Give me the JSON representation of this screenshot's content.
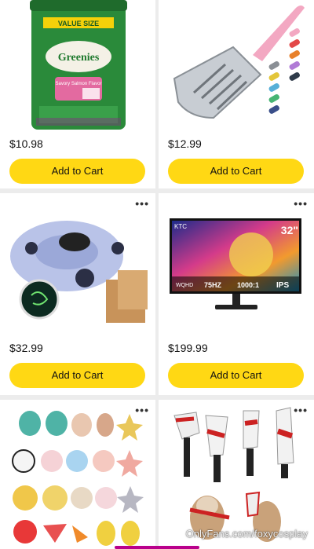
{
  "products": [
    {
      "price": "$10.98",
      "cta": "Add to Cart",
      "packaging_text": [
        "VALUE SIZE",
        "Greenies",
        "Savory Salmon Flavor"
      ]
    },
    {
      "price": "$12.99",
      "cta": "Add to Cart"
    },
    {
      "price": "$32.99",
      "cta": "Add to Cart"
    },
    {
      "price": "$199.99",
      "cta": "Add to Cart",
      "monitor_text": {
        "brand": "KTC",
        "size": "32\"",
        "spec1": "WQHD",
        "spec2": "75HZ",
        "spec3": "1000:1",
        "spec4": "IPS"
      }
    },
    {},
    {}
  ],
  "more_icon": "more-dots-icon",
  "watermark": "OnlyFans.com/foxycosplay",
  "colors": {
    "button": "#ffd814",
    "background": "#ececec",
    "card": "#ffffff"
  }
}
